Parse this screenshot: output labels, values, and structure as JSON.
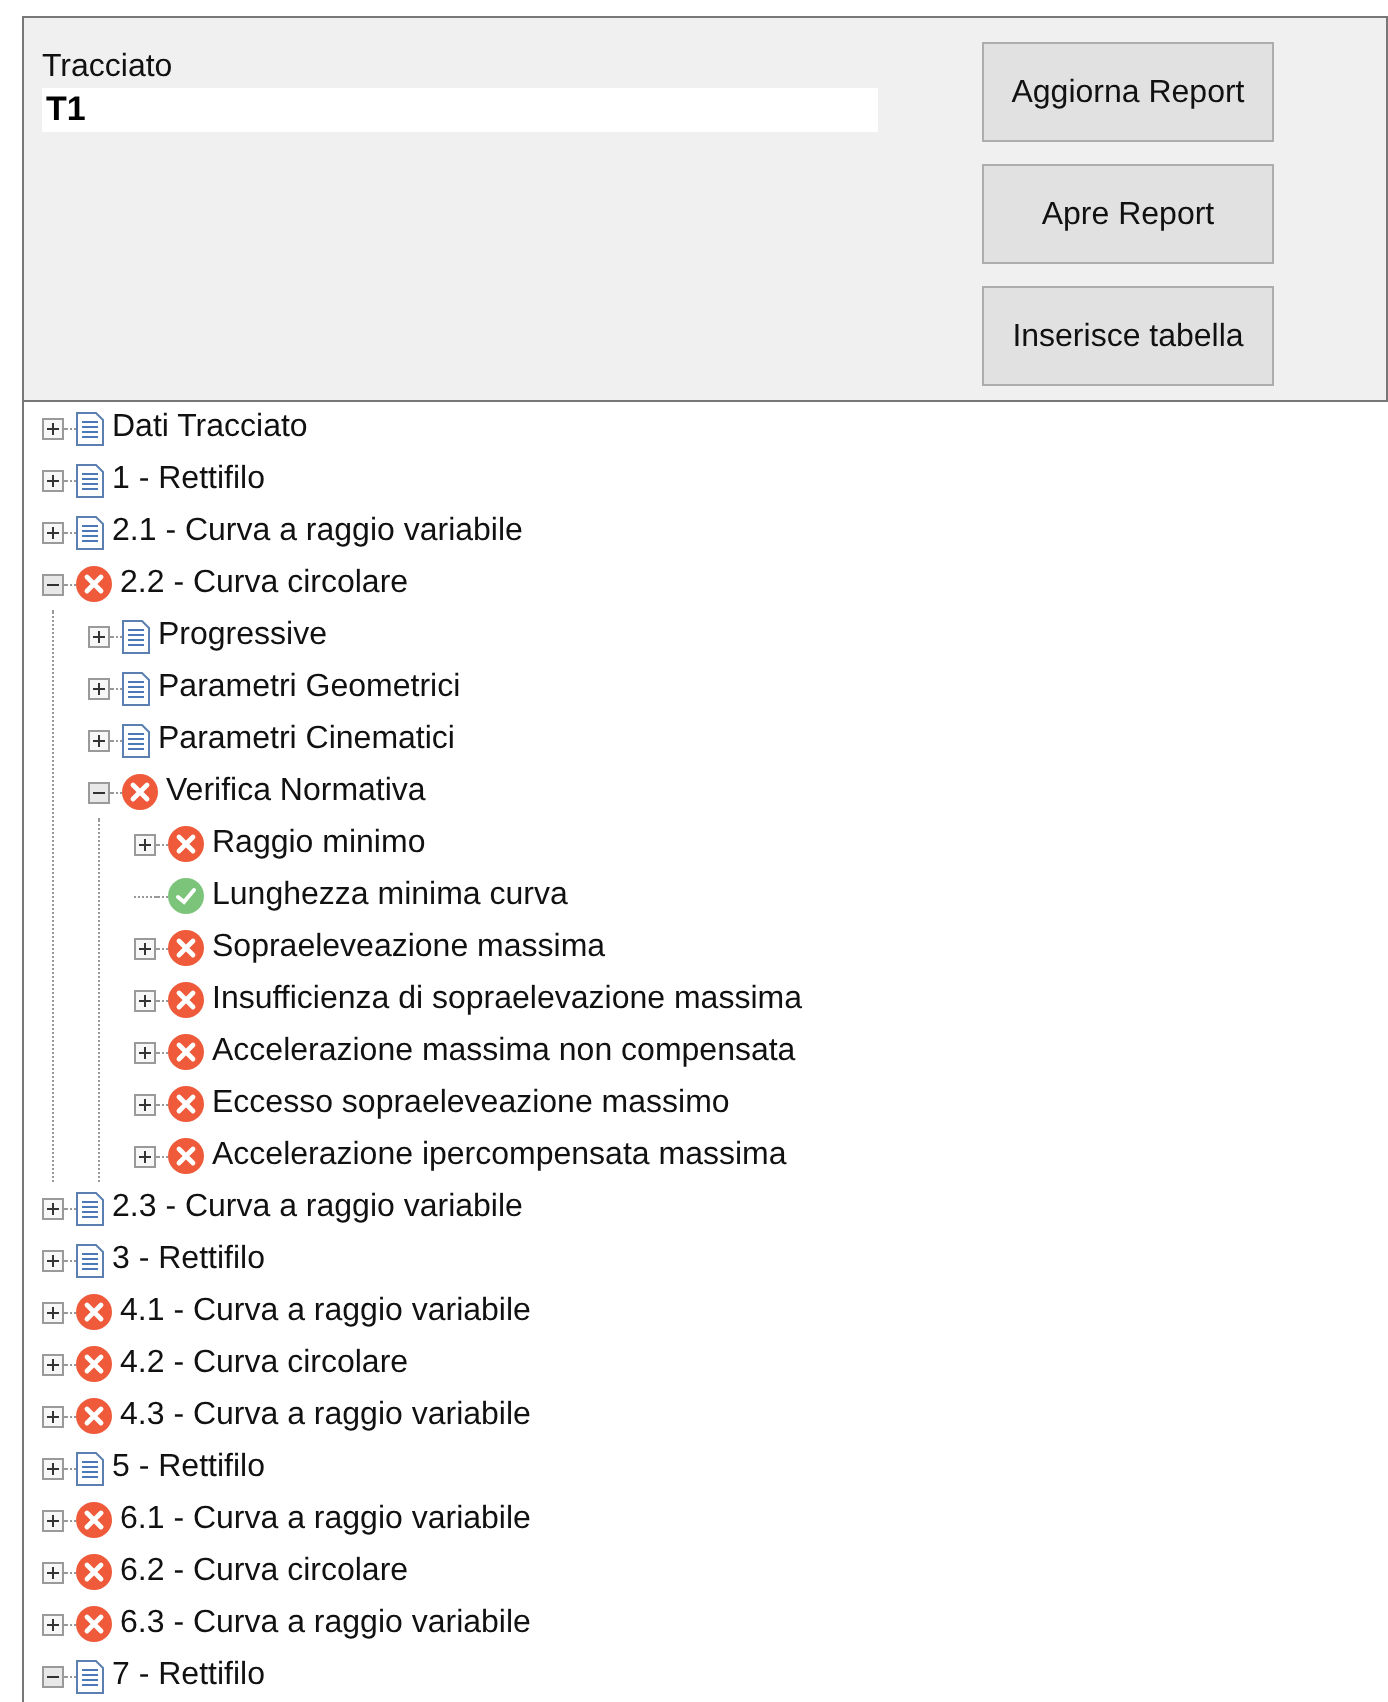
{
  "header": {
    "label": "Tracciato",
    "value": "T1",
    "buttons": [
      "Aggiorna Report",
      "Apre Report",
      "Inserisce tabella"
    ]
  },
  "tree": [
    {
      "label": "Dati Tracciato",
      "kind": "doc",
      "expandable": true,
      "expanded": false
    },
    {
      "label": "1 - Rettifilo",
      "kind": "doc",
      "expandable": true,
      "expanded": false
    },
    {
      "label": "2.1 - Curva a raggio variabile",
      "kind": "doc",
      "expandable": true,
      "expanded": false
    },
    {
      "label": "2.2 - Curva circolare",
      "kind": "error",
      "expandable": true,
      "expanded": true,
      "children": [
        {
          "label": "Progressive",
          "kind": "doc",
          "expandable": true,
          "expanded": false
        },
        {
          "label": "Parametri Geometrici",
          "kind": "doc",
          "expandable": true,
          "expanded": false
        },
        {
          "label": "Parametri Cinematici",
          "kind": "doc",
          "expandable": true,
          "expanded": false
        },
        {
          "label": "Verifica Normativa",
          "kind": "error",
          "expandable": true,
          "expanded": true,
          "children": [
            {
              "label": "Raggio minimo",
              "kind": "error",
              "expandable": true,
              "expanded": false
            },
            {
              "label": "Lunghezza minima curva",
              "kind": "ok",
              "expandable": false
            },
            {
              "label": "Sopraeleveazione massima",
              "kind": "error",
              "expandable": true,
              "expanded": false
            },
            {
              "label": "Insufficienza di sopraelevazione massima",
              "kind": "error",
              "expandable": true,
              "expanded": false
            },
            {
              "label": "Accelerazione massima non compensata",
              "kind": "error",
              "expandable": true,
              "expanded": false
            },
            {
              "label": "Eccesso sopraeleveazione massimo",
              "kind": "error",
              "expandable": true,
              "expanded": false
            },
            {
              "label": "Accelerazione ipercompensata massima",
              "kind": "error",
              "expandable": true,
              "expanded": false
            }
          ]
        }
      ]
    },
    {
      "label": "2.3 - Curva a raggio variabile",
      "kind": "doc",
      "expandable": true,
      "expanded": false
    },
    {
      "label": "3 - Rettifilo",
      "kind": "doc",
      "expandable": true,
      "expanded": false
    },
    {
      "label": "4.1 - Curva a raggio variabile",
      "kind": "error",
      "expandable": true,
      "expanded": false
    },
    {
      "label": "4.2 - Curva circolare",
      "kind": "error",
      "expandable": true,
      "expanded": false
    },
    {
      "label": "4.3 - Curva a raggio variabile",
      "kind": "error",
      "expandable": true,
      "expanded": false
    },
    {
      "label": "5 - Rettifilo",
      "kind": "doc",
      "expandable": true,
      "expanded": false
    },
    {
      "label": "6.1 - Curva a raggio variabile",
      "kind": "error",
      "expandable": true,
      "expanded": false
    },
    {
      "label": "6.2 - Curva circolare",
      "kind": "error",
      "expandable": true,
      "expanded": false
    },
    {
      "label": "6.3 - Curva a raggio variabile",
      "kind": "error",
      "expandable": true,
      "expanded": false
    },
    {
      "label": "7 - Rettifilo",
      "kind": "doc",
      "expandable": true,
      "expanded": true
    }
  ]
}
